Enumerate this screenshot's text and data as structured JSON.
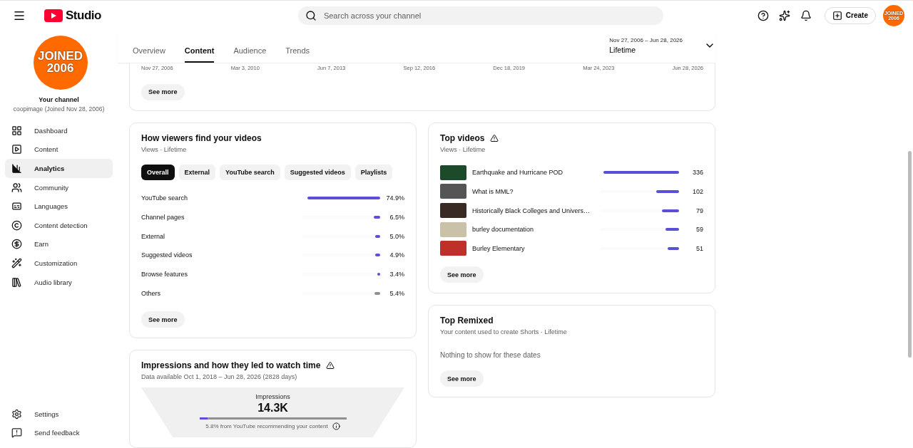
{
  "header": {
    "brand": "Studio",
    "search": {
      "placeholder": "Search across your channel"
    },
    "create_label": "Create",
    "avatar_text": "JOINED 2006"
  },
  "channel": {
    "avatar_text": "JOINED 2006",
    "title": "Your channel",
    "subtitle": "coopimage (Joined Nov 28, 2006)"
  },
  "sidebar": {
    "items": [
      {
        "label": "Dashboard",
        "selected": false
      },
      {
        "label": "Content",
        "selected": false
      },
      {
        "label": "Analytics",
        "selected": true
      },
      {
        "label": "Community",
        "selected": false
      },
      {
        "label": "Languages",
        "selected": false
      },
      {
        "label": "Content detection",
        "selected": false
      },
      {
        "label": "Earn",
        "selected": false
      },
      {
        "label": "Customization",
        "selected": false
      },
      {
        "label": "Audio library",
        "selected": false
      }
    ],
    "footer_items": [
      {
        "label": "Settings"
      },
      {
        "label": "Send feedback"
      }
    ]
  },
  "tabs": [
    {
      "label": "Overview",
      "selected": false
    },
    {
      "label": "Content",
      "selected": true
    },
    {
      "label": "Audience",
      "selected": false
    },
    {
      "label": "Trends",
      "selected": false
    }
  ],
  "date_range": {
    "range": "Nov 27, 2006 – Jun 28, 2026",
    "label": "Lifetime"
  },
  "views_card": {
    "axis_labels": [
      "Nov 27, 2006",
      "Mar 3, 2010",
      "Jun 7, 2013",
      "Sep 12, 2016",
      "Dec 18, 2019",
      "Mar 24, 2023",
      "Jun 28, 2026"
    ],
    "button": "See more"
  },
  "traffic_card": {
    "title": "How viewers find your videos",
    "subtitle": "Views · Lifetime",
    "filters": [
      {
        "label": "Overall",
        "selected": true
      },
      {
        "label": "External",
        "selected": false
      },
      {
        "label": "YouTube search",
        "selected": false
      },
      {
        "label": "Suggested videos",
        "selected": false
      },
      {
        "label": "Playlists",
        "selected": false
      }
    ],
    "rows": [
      {
        "label": "YouTube search",
        "value": "74.9%",
        "level": 0.93,
        "color": "#5a4fd6"
      },
      {
        "label": "Channel pages",
        "value": "6.5%",
        "level": 0.08,
        "color": "#5a4fd6"
      },
      {
        "label": "External",
        "value": "5.0%",
        "level": 0.06,
        "color": "#5a4fd6"
      },
      {
        "label": "Suggested videos",
        "value": "4.9%",
        "level": 0.06,
        "color": "#5a4fd6"
      },
      {
        "label": "Browse features",
        "value": "3.4%",
        "level": 0.04,
        "color": "#5a4fd6"
      },
      {
        "label": "Others",
        "value": "5.4%",
        "level": 0.07,
        "color": "#909090"
      }
    ],
    "button": "See more"
  },
  "top_videos": {
    "title": "Top videos",
    "subtitle": "Views · Lifetime",
    "rows": [
      {
        "title": "Earthquake and Hurricane POD",
        "value": "336",
        "level": 0.96
      },
      {
        "title": "What is MML?",
        "value": "102",
        "level": 0.29
      },
      {
        "title": "Historically Black Colleges and Univers…",
        "value": "79",
        "level": 0.22
      },
      {
        "title": "burley documentation",
        "value": "59",
        "level": 0.17
      },
      {
        "title": "Burley Elementary",
        "value": "51",
        "level": 0.15
      }
    ],
    "button": "See more"
  },
  "top_remixed": {
    "title": "Top Remixed",
    "subtitle": "Your content used to create Shorts · Lifetime",
    "empty": "Nothing to show for these dates",
    "button": "See more"
  },
  "impressions": {
    "title": "Impressions and how they led to watch time",
    "subtitle": "Data available Oct 1, 2018 – Jun 28, 2026 (2828 days)",
    "label": "Impressions",
    "value": "14.3K",
    "level": 0.058,
    "caption": "5.8% from YouTube recommending your content"
  }
}
